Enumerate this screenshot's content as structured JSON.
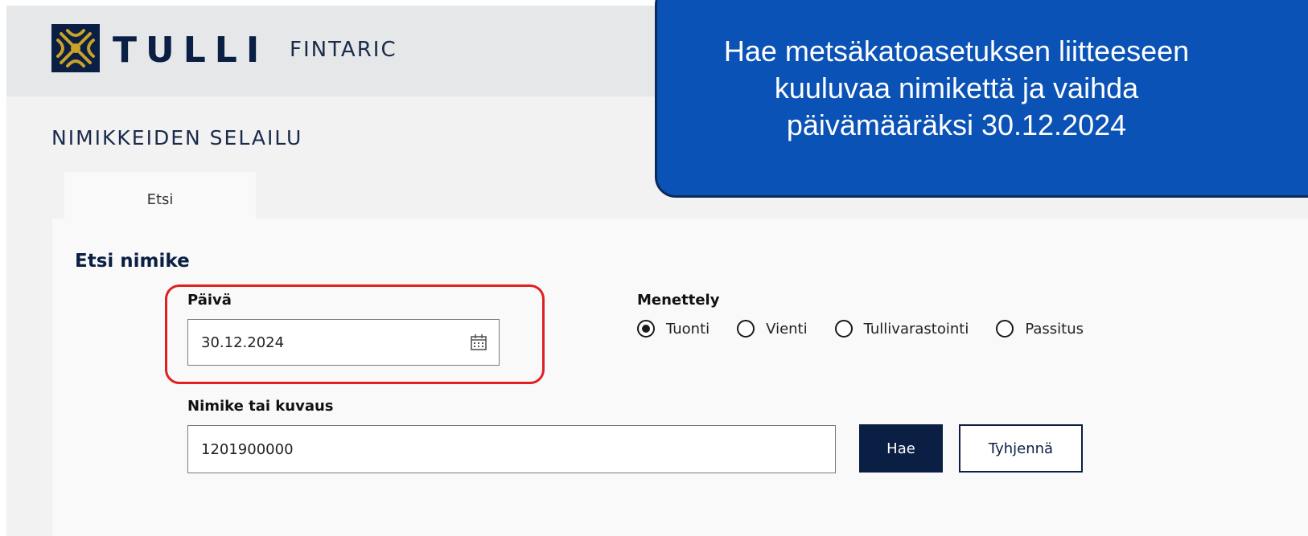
{
  "header": {
    "brand": "TULLI",
    "subbrand": "FINTARIC",
    "logo_icon": "customs-emblem-icon"
  },
  "page": {
    "title": "NIMIKKEIDEN SELAILU"
  },
  "tabs": [
    {
      "label": "Etsi",
      "active": true
    }
  ],
  "form": {
    "title": "Etsi nimike",
    "date": {
      "label": "Päivä",
      "value": "30.12.2024",
      "icon": "calendar-icon"
    },
    "procedure": {
      "label": "Menettely",
      "options": [
        {
          "label": "Tuonti",
          "checked": true
        },
        {
          "label": "Vienti",
          "checked": false
        },
        {
          "label": "Tullivarastointi",
          "checked": false
        },
        {
          "label": "Passitus",
          "checked": false
        }
      ]
    },
    "code": {
      "label": "Nimike tai kuvaus",
      "value": "1201900000"
    },
    "search_button": "Hae",
    "clear_button": "Tyhjennä"
  },
  "callout": {
    "lines": [
      "Hae metsäkatoasetuksen liitteeseen",
      "kuuluvaa nimikettä ja vaihda",
      "päivämääräksi 30.12.2024"
    ]
  },
  "colors": {
    "navy": "#0b1f44",
    "callout_blue": "#0a52b5",
    "highlight_red": "#e02020"
  }
}
